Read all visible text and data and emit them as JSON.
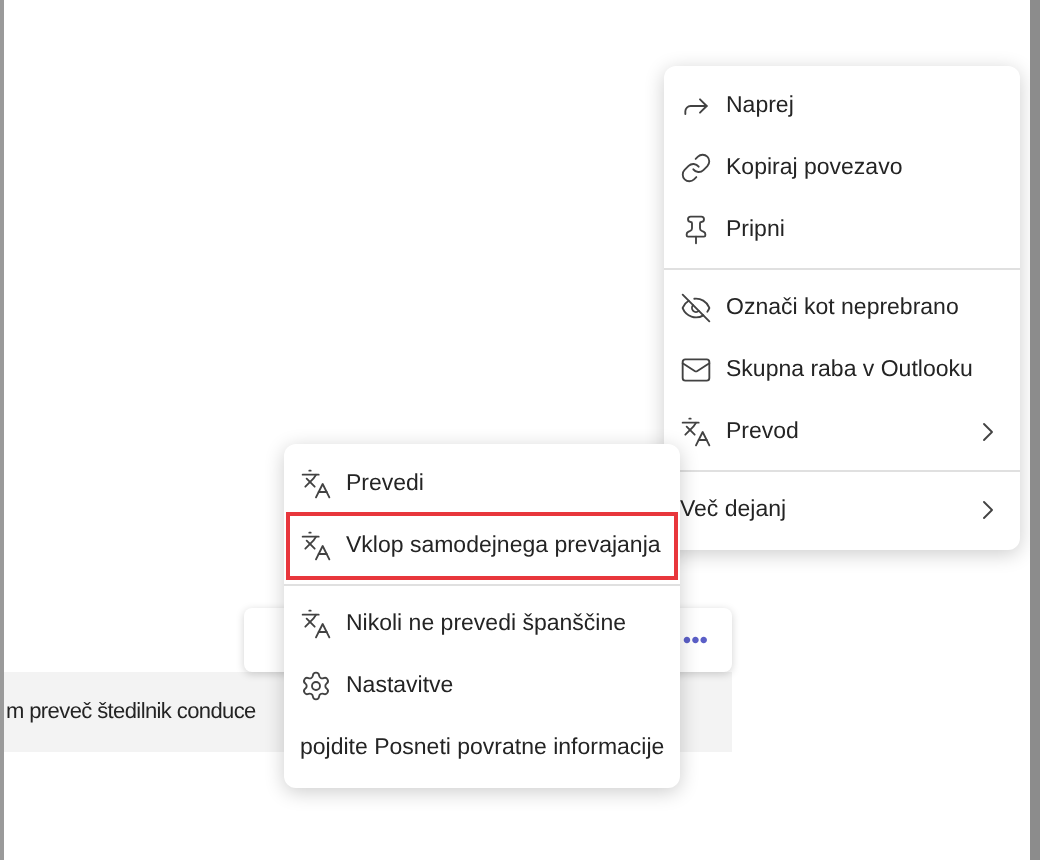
{
  "message": {
    "text": "m preveč štedilnik conduce"
  },
  "toolbar": {
    "more": "•••"
  },
  "menu": {
    "sections": [
      [
        {
          "label": "Naprej",
          "has_submenu": false
        },
        {
          "label": "Kopiraj povezavo",
          "has_submenu": false
        },
        {
          "label": "Pripni",
          "has_submenu": false
        }
      ],
      [
        {
          "label": "Označi kot neprebrano",
          "has_submenu": false
        },
        {
          "label": "Skupna raba v Outlooku",
          "has_submenu": false
        },
        {
          "label": "Prevod",
          "has_submenu": true
        }
      ],
      [
        {
          "label": "Več dejanj",
          "has_submenu": true
        }
      ]
    ]
  },
  "submenu": {
    "sections": [
      [
        {
          "label": "Prevedi",
          "highlighted": false
        },
        {
          "label": "Vklop samodejnega prevajanja",
          "highlighted": true
        }
      ],
      [
        {
          "label": "Nikoli ne prevedi španščine",
          "highlighted": false
        },
        {
          "label": "Nastavitve",
          "highlighted": false
        },
        {
          "label": "pojdite Posneti povratne informacije",
          "highlighted": false
        }
      ]
    ]
  }
}
